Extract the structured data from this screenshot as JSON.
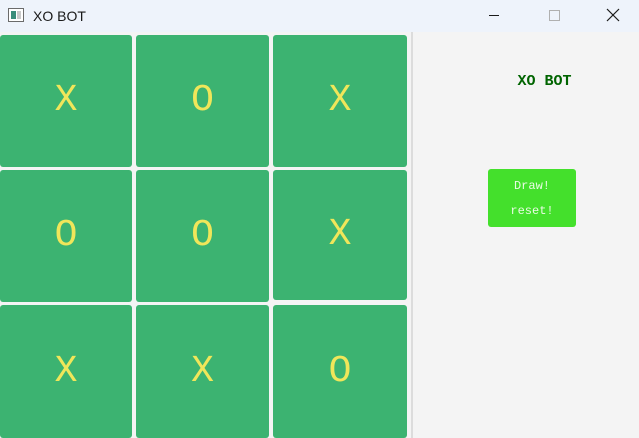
{
  "window": {
    "title": "XO BOT"
  },
  "board": {
    "cells": [
      "X",
      "O",
      "X",
      "O",
      "O",
      "X",
      "X",
      "X",
      "O"
    ]
  },
  "side_panel": {
    "title": "XO BOT",
    "status_text": "Draw!",
    "reset_label": "reset!"
  },
  "colors": {
    "cell_bg": "#3cb371",
    "mark": "#f0e65a",
    "panel_title": "#006400",
    "reset_button": "#44e02c",
    "titlebar_bg": "#eef3fb"
  },
  "icons": {
    "app": "app-window-icon",
    "minimize": "minimize-icon",
    "maximize": "maximize-icon",
    "close": "close-icon"
  }
}
